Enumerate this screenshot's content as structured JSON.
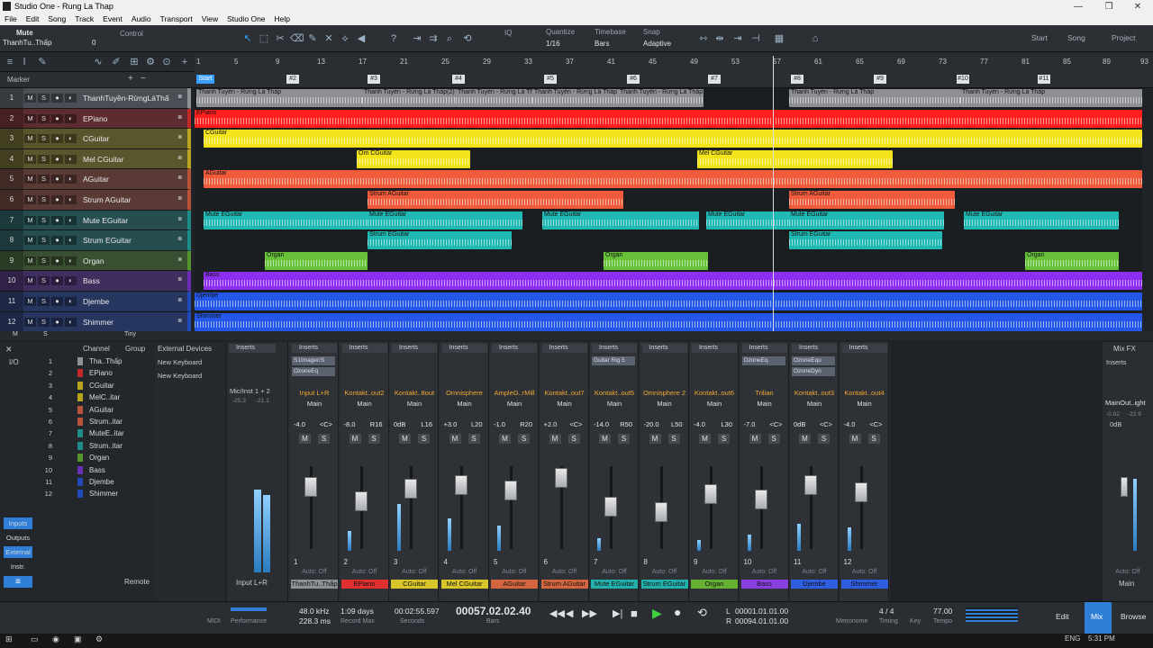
{
  "window": {
    "title": "Studio One - Rung La Thap",
    "controls": [
      "—",
      "❐",
      "✕"
    ]
  },
  "menu": [
    "File",
    "Edit",
    "Song",
    "Track",
    "Event",
    "Audio",
    "Transport",
    "View",
    "Studio One",
    "Help"
  ],
  "toolbar": {
    "inspector_name": "Mute",
    "inspector_track": "ThanhTu..Thấp",
    "inspector_val": "0",
    "control_label": "Control",
    "quantize_label": "Quantize",
    "quantize_value": "1/16",
    "timebase_label": "Timebase",
    "timebase_value": "Bars",
    "snap_label": "Snap",
    "snap_value": "Adaptive",
    "nav": [
      "Start",
      "Song",
      "Project"
    ]
  },
  "ruler": {
    "numbers": [
      "1",
      "5",
      "9",
      "13",
      "17",
      "21",
      "25",
      "29",
      "33",
      "37",
      "41",
      "45",
      "49",
      "53",
      "57",
      "61",
      "65",
      "69",
      "73",
      "77",
      "81",
      "85",
      "89",
      "93"
    ]
  },
  "markers": {
    "label": "Marker",
    "items": [
      "Start",
      "#2",
      "#3",
      "#4",
      "#5",
      "#6",
      "#7",
      "#8",
      "#9",
      "#10",
      "#11"
    ]
  },
  "tracks": [
    {
      "num": "1",
      "name": "ThanhTuyền-RừngLáThấp",
      "color": "#8e9298"
    },
    {
      "num": "2",
      "name": "EPiano",
      "color": "#c22a2a"
    },
    {
      "num": "3",
      "name": "CGuitar",
      "color": "#b6a51d"
    },
    {
      "num": "4",
      "name": "Mel CGuitar",
      "color": "#b6a51d"
    },
    {
      "num": "5",
      "name": "AGuitar",
      "color": "#b8533a"
    },
    {
      "num": "6",
      "name": "Strum AGuitar",
      "color": "#b8533a"
    },
    {
      "num": "7",
      "name": "Mute EGuitar",
      "color": "#1e8d8a"
    },
    {
      "num": "8",
      "name": "Strum EGuitar",
      "color": "#1e8d8a"
    },
    {
      "num": "9",
      "name": "Organ",
      "color": "#56942c"
    },
    {
      "num": "10",
      "name": "Bass",
      "color": "#6a2fb5"
    },
    {
      "num": "11",
      "name": "Djembe",
      "color": "#2149b8"
    },
    {
      "num": "12",
      "name": "Shimmer",
      "color": "#2149b8"
    }
  ],
  "track_buttons": [
    "M",
    "S",
    "●",
    "◐"
  ],
  "track_footer": [
    "M",
    "S",
    "Tiny"
  ],
  "clips": {
    "t1": "Thanh Tuyền - Rừng Lá Thấp",
    "t1b": "Thanh Tuyền - Rừng Lá Thấp(2)",
    "t2": "EPiano",
    "t3": "CGuitar",
    "t4": "Om CGuitar",
    "t4b": "Mel CGuitar",
    "t5": "AGuitar",
    "t6": "Strum AGuitar",
    "t7": "Mute EGuitar",
    "t8": "Strum EGuitar",
    "t9": "Organ",
    "t10": "Bass",
    "t11": "Djembe",
    "t12": "Shimmer"
  },
  "browser": {
    "tabs": [
      "Channel",
      "Group"
    ],
    "io": "I/O",
    "channels": [
      "Tha..Thấp",
      "EPiano",
      "CGuitar",
      "MelC..itar",
      "AGuitar",
      "Strum..itar",
      "MuteE..itar",
      "Strum..itar",
      "Organ",
      "Bass",
      "Djembe",
      "Shimmer"
    ],
    "side": [
      "Inputs",
      "Outputs",
      "External",
      "Instr."
    ],
    "remote": "Remote"
  },
  "external_devices": {
    "title": "External Devices",
    "items": [
      "New Keyboard",
      "New Keyboard"
    ]
  },
  "mixer": {
    "input_strip": {
      "label": "Mic/Inst 1 + 2",
      "meter_top": "-25.3",
      "meter_top2": "-21.1",
      "name": "Input L+R"
    },
    "strips": [
      {
        "ins": "Inserts",
        "slots": [
          "S1Imager/S",
          "OzoneEq"
        ],
        "io": "Input L+R",
        "vol": "-4.0",
        "pan": "<C>",
        "num": "1",
        "name": "ThanhTu..Thấp",
        "color": "#8e9298"
      },
      {
        "ins": "Inserts",
        "slots": [],
        "io": "Kontakt..out2",
        "vol": "-8.0",
        "pan": "R16",
        "num": "2",
        "name": "EPiano",
        "color": "#e23030"
      },
      {
        "ins": "Inserts",
        "slots": [],
        "io": "Kontakt..8out",
        "vol": "0dB",
        "pan": "L16",
        "num": "3",
        "name": "CGuitar",
        "color": "#d8c52a"
      },
      {
        "ins": "Inserts",
        "slots": [],
        "io": "Omnisphere",
        "vol": "+3.0",
        "pan": "L20",
        "num": "4",
        "name": "Mel CGuitar",
        "color": "#d8c52a"
      },
      {
        "ins": "Inserts",
        "slots": [],
        "io": "AmpleG..rMill",
        "vol": "-1.0",
        "pan": "R20",
        "num": "5",
        "name": "AGuitar",
        "color": "#d4663f"
      },
      {
        "ins": "Inserts",
        "slots": [],
        "io": "Kontakt..out7",
        "vol": "+2.0",
        "pan": "<C>",
        "num": "6",
        "name": "Strum AGuitar",
        "color": "#d4663f"
      },
      {
        "ins": "Inserts",
        "slots": [
          "Guitar Rig 5"
        ],
        "io": "Kontakt..out5",
        "vol": "-14.0",
        "pan": "R50",
        "num": "7",
        "name": "Mute EGuitar",
        "color": "#23b0aa"
      },
      {
        "ins": "Inserts",
        "slots": [],
        "io": "Omnisphere 2",
        "vol": "-20.0",
        "pan": "L50",
        "num": "8",
        "name": "Strum EGuitar",
        "color": "#23b0aa"
      },
      {
        "ins": "Inserts",
        "slots": [],
        "io": "Kontakt..out6",
        "vol": "-4.0",
        "pan": "L30",
        "num": "9",
        "name": "Organ",
        "color": "#66b133"
      },
      {
        "ins": "Inserts",
        "slots": [
          "OzoneEq"
        ],
        "io": "Trilian",
        "vol": "-7.0",
        "pan": "<C>",
        "num": "10",
        "name": "Bass",
        "color": "#8a3fe0"
      },
      {
        "ins": "Inserts",
        "slots": [
          "OzoneEqu",
          "OzoneDyn"
        ],
        "io": "Kontakt..out3",
        "vol": "0dB",
        "pan": "<C>",
        "num": "11",
        "name": "Djembe",
        "color": "#2f5ee0"
      },
      {
        "ins": "Inserts",
        "slots": [],
        "io": "Kontakt..out4",
        "vol": "-4.0",
        "pan": "<C>",
        "num": "12",
        "name": "Shimmer",
        "color": "#2f5ee0"
      }
    ],
    "main_label": "Main",
    "auto_label": "Auto: Off",
    "mix_fx": "Mix FX",
    "main_out": {
      "io": "MainOut..ight",
      "v1": "-0.82",
      "v2": "-22.9",
      "vol": "0dB",
      "name": "Main"
    }
  },
  "transport": {
    "midi": "MIDI",
    "performance": "Performance",
    "samplerate": "48.0 kHz",
    "latency": "228.3 ms",
    "record_days": "1:09 days",
    "record_label": "Record Max",
    "seconds": "00:02:55.597",
    "seconds_label": "Seconds",
    "bars": "00057.02.02.40",
    "bars_label": "Bars",
    "loop_l": "00001.01.01.00",
    "loop_r": "00094.01.01.00",
    "metronome_label": "Metronome",
    "timing": "4 / 4",
    "timing_label": "Timing",
    "key_label": "Key",
    "tempo": "77.00",
    "tempo_label": "Tempo",
    "views": [
      "Edit",
      "Mix",
      "Browse"
    ]
  },
  "taskbar": {
    "lang": "ENG",
    "time": "5:31 PM"
  }
}
